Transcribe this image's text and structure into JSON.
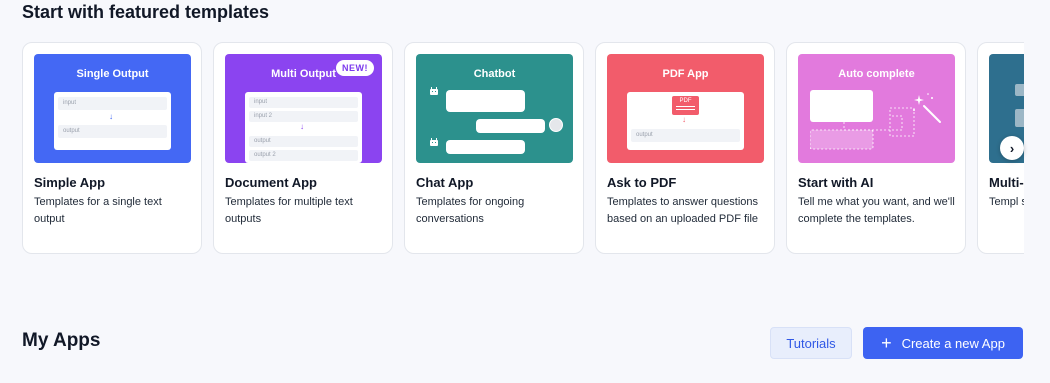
{
  "featured": {
    "title": "Start with featured templates",
    "cards": [
      {
        "thumb_title": "Single Output",
        "thumb_color": "#4468f4",
        "title": "Simple App",
        "description": "Templates for a single text output",
        "preview": {
          "input": "input",
          "output": "output"
        }
      },
      {
        "thumb_title": "Multi Output",
        "thumb_color": "#8b44f0",
        "badge": "NEW!",
        "title": "Document App",
        "description": "Templates for multiple text outputs",
        "preview": {
          "input1": "input",
          "input2": "input 2",
          "output1": "output",
          "output2": "output 2"
        }
      },
      {
        "thumb_title": "Chatbot",
        "thumb_color": "#2c918d",
        "title": "Chat App",
        "description": "Templates for ongoing conversations"
      },
      {
        "thumb_title": "PDF App",
        "thumb_color": "#f25c6b",
        "title": "Ask to PDF",
        "description": "Templates to answer questions based on an uploaded PDF file",
        "preview": {
          "pdf": "PDF",
          "output": "output"
        }
      },
      {
        "thumb_title": "Auto complete",
        "thumb_color": "#e27add",
        "title": "Start with AI",
        "description": "Tell me what you want, and we'll complete the templates."
      },
      {
        "thumb_title": "",
        "thumb_color": "#2e6f8e",
        "title": "Multi-",
        "description": "Templ sequen"
      }
    ]
  },
  "my_apps": {
    "title": "My Apps",
    "tutorials_label": "Tutorials",
    "create_label": "Create a new App"
  },
  "icons": {
    "next": "chevron-right-icon",
    "plus": "plus-icon",
    "bot": "robot-icon",
    "wand": "magic-wand-icon"
  }
}
